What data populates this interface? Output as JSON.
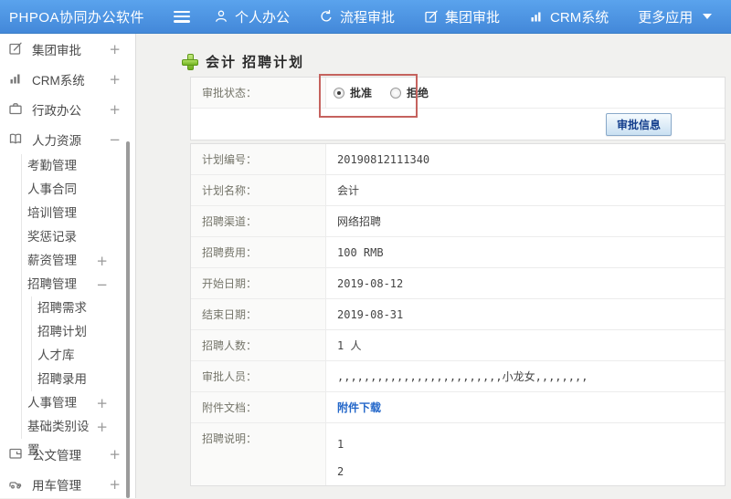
{
  "header": {
    "logo": "PHPOA协同办公软件",
    "nav": [
      {
        "label": "个人办公",
        "icon": "user-icon"
      },
      {
        "label": "流程审批",
        "icon": "process-icon"
      },
      {
        "label": "集团审批",
        "icon": "edit-icon"
      },
      {
        "label": "CRM系统",
        "icon": "chart-icon"
      },
      {
        "label": "更多应用",
        "icon": "caret-down-icon"
      }
    ]
  },
  "sidebar": {
    "items": [
      {
        "label": "集团审批",
        "icon": "edit-icon",
        "toggle": "+"
      },
      {
        "label": "CRM系统",
        "icon": "chart-icon",
        "toggle": "+"
      },
      {
        "label": "行政办公",
        "icon": "briefcase-icon",
        "toggle": "+"
      },
      {
        "label": "人力资源",
        "icon": "book-icon",
        "toggle": "−"
      },
      {
        "label": "考勤管理"
      },
      {
        "label": "人事合同"
      },
      {
        "label": "培训管理"
      },
      {
        "label": "奖惩记录"
      },
      {
        "label": "薪资管理",
        "toggle": "+"
      },
      {
        "label": "招聘管理",
        "toggle": "−"
      },
      {
        "label": "招聘需求"
      },
      {
        "label": "招聘计划"
      },
      {
        "label": "人才库"
      },
      {
        "label": "招聘录用"
      },
      {
        "label": "人事管理",
        "toggle": "+"
      },
      {
        "label": "基础类别设置",
        "toggle": "+"
      },
      {
        "label": "公文管理",
        "icon": "document-icon",
        "toggle": "+"
      },
      {
        "label": "用车管理",
        "icon": "car-icon",
        "toggle": "+"
      }
    ]
  },
  "main": {
    "title": "会计 招聘计划",
    "status": {
      "label": "审批状态：",
      "options": [
        {
          "label": "批准",
          "checked": true
        },
        {
          "label": "拒绝",
          "checked": false
        }
      ]
    },
    "approval_button": "审批信息",
    "fields": [
      {
        "label": "计划编号：",
        "value": "20190812111340"
      },
      {
        "label": "计划名称：",
        "value": "会计"
      },
      {
        "label": "招聘渠道：",
        "value": "网络招聘"
      },
      {
        "label": "招聘费用：",
        "value": "100 RMB"
      },
      {
        "label": "开始日期：",
        "value": "2019-08-12"
      },
      {
        "label": "结束日期：",
        "value": "2019-08-31"
      },
      {
        "label": "招聘人数：",
        "value": "1 人"
      },
      {
        "label": "审批人员：",
        "value": ",,,,,,,,,,,,,,,,,,,,,,,,,小龙女,,,,,,,,"
      },
      {
        "label": "附件文档：",
        "value": "附件下载"
      },
      {
        "label": "招聘说明：",
        "value": "1\n2"
      }
    ],
    "colors": {
      "accent_blue": "#4388d9",
      "annotation_red": "#c5625e",
      "link_blue": "#2367c9",
      "plus_green": "#74b524"
    }
  }
}
